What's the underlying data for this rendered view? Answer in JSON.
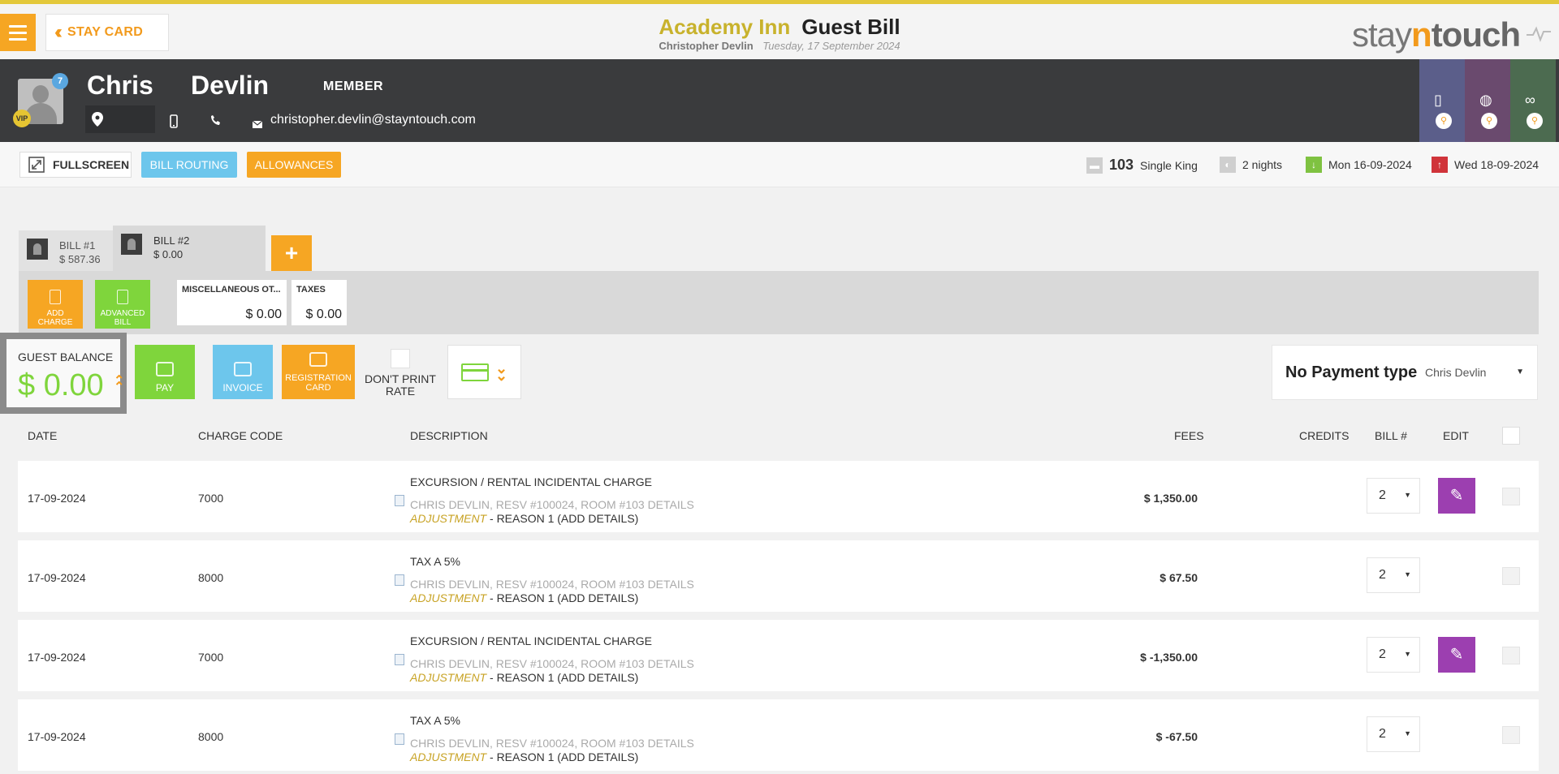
{
  "topbar": {
    "stay_card_label": "STAY CARD",
    "hotel_name": "Academy Inn",
    "page_title": "Guest Bill",
    "guest_name": "Christopher Devlin",
    "date": "Tuesday, 17 September 2024",
    "logo_stay": "stay",
    "logo_n": "n",
    "logo_touch": "touch"
  },
  "guest": {
    "first_name": "Chris",
    "last_name": "Devlin",
    "membership": "MEMBER",
    "badge_count": "7",
    "vip": "VIP",
    "email": "christopher.devlin@stayntouch.com",
    "side_tiles": [
      {
        "color": "#5b5e8a",
        "icon": "building-icon"
      },
      {
        "color": "#6a4a6e",
        "icon": "globe-icon"
      },
      {
        "color": "#4c6b50",
        "icon": "circles-icon"
      }
    ]
  },
  "toolbar": {
    "fullscreen_label": "FULLSCREEN",
    "bill_routing_label": "BILL ROUTING",
    "allowances_label": "ALLOWANCES",
    "room_number": "103",
    "room_type": "Single King",
    "nights": "2 nights",
    "arrival": "Mon 16-09-2024",
    "departure": "Wed 18-09-2024"
  },
  "bills": {
    "tabs": [
      {
        "label": "BILL #1",
        "amount": "$ 587.36"
      },
      {
        "label": "BILL #2",
        "amount": "$ 0.00"
      }
    ],
    "add_charge_label_1": "ADD",
    "add_charge_label_2": "CHARGE",
    "advanced_bill_label_1": "ADVANCED",
    "advanced_bill_label_2": "BILL",
    "summaries": [
      {
        "label": "MISCELLANEOUS OT...",
        "value": "$ 0.00"
      },
      {
        "label": "TAXES",
        "value": "$ 0.00"
      }
    ]
  },
  "balance": {
    "label": "GUEST BALANCE",
    "value": "$ 0.00",
    "pay_label": "PAY",
    "invoice_label": "INVOICE",
    "registration_label_1": "REGISTRATION",
    "registration_label_2": "CARD",
    "dont_print_label_1": "DON'T PRINT",
    "dont_print_label_2": "RATE",
    "payment_type": "No Payment type",
    "payer": "Chris Devlin"
  },
  "table": {
    "headers": {
      "date": "DATE",
      "charge_code": "CHARGE CODE",
      "description": "DESCRIPTION",
      "fees": "FEES",
      "credits": "CREDITS",
      "bill_no": "BILL #",
      "edit": "EDIT"
    },
    "rows": [
      {
        "date": "17-09-2024",
        "code": "7000",
        "description": "EXCURSION / RENTAL INCIDENTAL CHARGE",
        "details": "CHRIS DEVLIN, RESV #100024, ROOM #103 DETAILS",
        "adjustment": "ADJUSTMENT",
        "reason": " - REASON 1 (ADD DETAILS)",
        "fees": "$ 1,350.00",
        "bill": "2",
        "editable": true
      },
      {
        "date": "17-09-2024",
        "code": "8000",
        "description": "TAX A 5%",
        "details": "CHRIS DEVLIN, RESV #100024, ROOM #103 DETAILS",
        "adjustment": "ADJUSTMENT",
        "reason": " - REASON 1 (ADD DETAILS)",
        "fees": "$ 67.50",
        "bill": "2",
        "editable": false
      },
      {
        "date": "17-09-2024",
        "code": "7000",
        "description": "EXCURSION / RENTAL INCIDENTAL CHARGE",
        "details": "CHRIS DEVLIN, RESV #100024, ROOM #103 DETAILS",
        "adjustment": "ADJUSTMENT",
        "reason": " - REASON 1 (ADD DETAILS)",
        "fees": "$ -1,350.00",
        "bill": "2",
        "editable": true
      },
      {
        "date": "17-09-2024",
        "code": "8000",
        "description": "TAX A 5%",
        "details": "CHRIS DEVLIN, RESV #100024, ROOM #103 DETAILS",
        "adjustment": "ADJUSTMENT",
        "reason": " - REASON 1 (ADD DETAILS)",
        "fees": "$ -67.50",
        "bill": "2",
        "editable": false
      }
    ]
  },
  "colors": {
    "accent_orange": "#f6a623",
    "accent_green": "#7fd53c",
    "accent_blue": "#6dc6ec",
    "edit_purple": "#9c3fb0",
    "header_dark": "#3a3b3d",
    "hotel_gold": "#c8b22c"
  }
}
